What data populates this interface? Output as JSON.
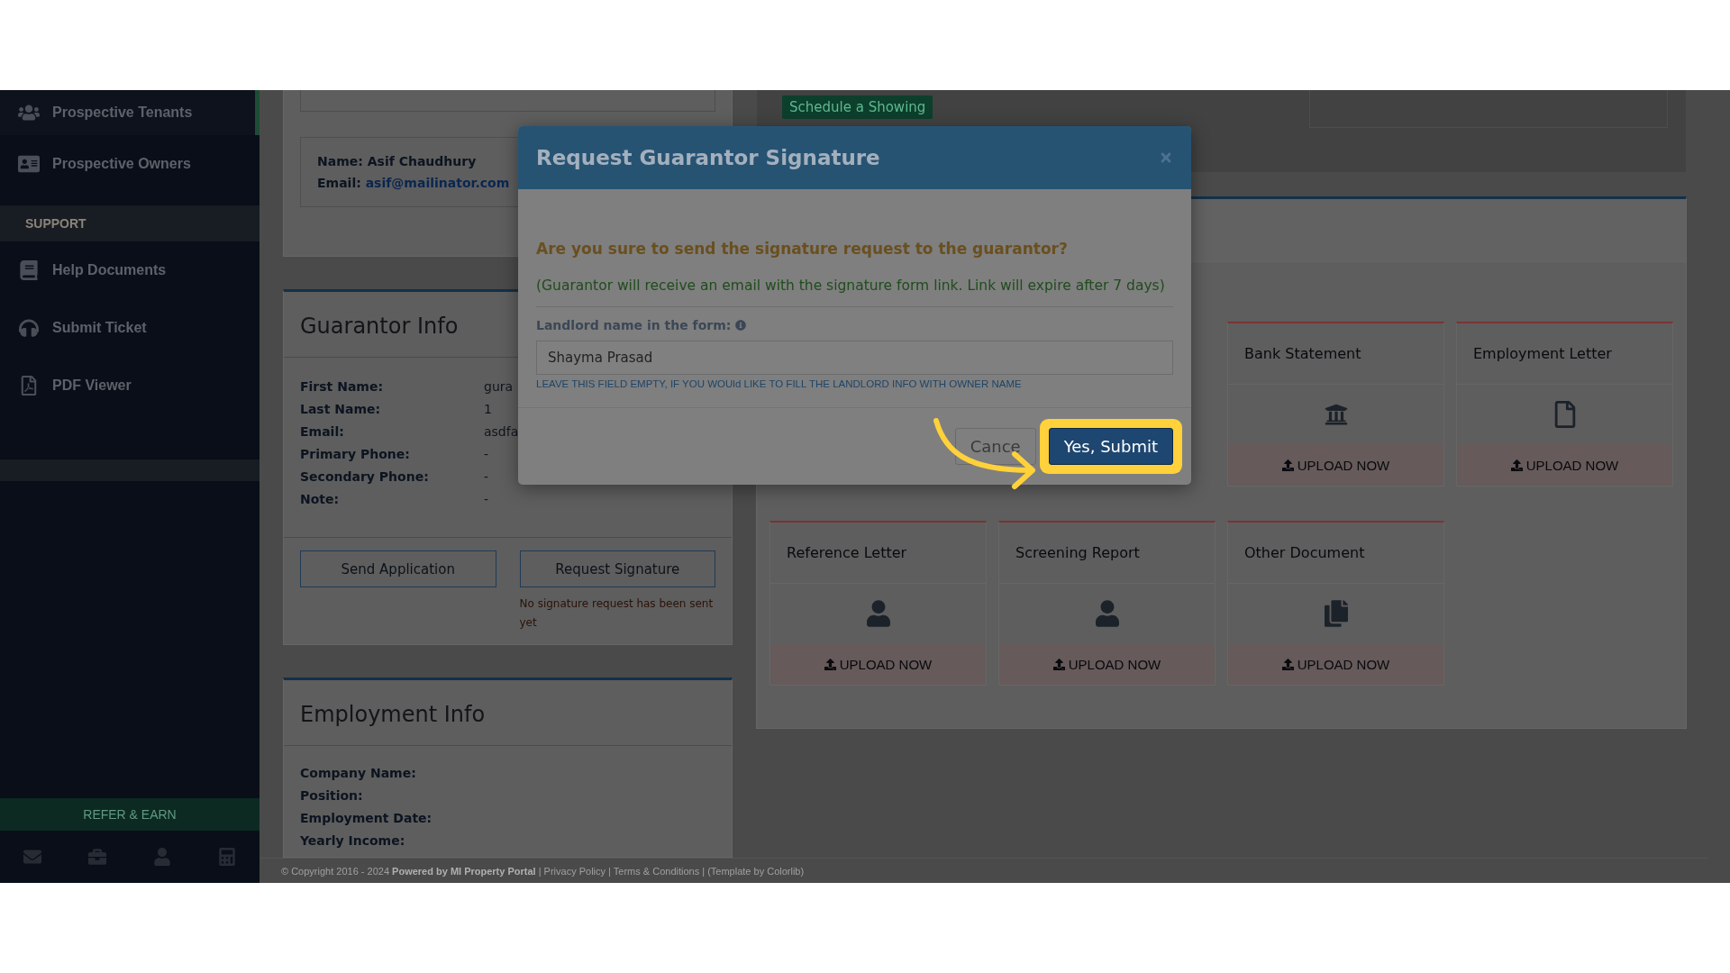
{
  "sidebar": {
    "items": [
      {
        "label": "Prospective Tenants",
        "selected": true
      },
      {
        "label": "Prospective Owners",
        "selected": false
      }
    ],
    "section": "SUPPORT",
    "support_items": [
      {
        "label": "Help Documents"
      },
      {
        "label": "Submit Ticket"
      },
      {
        "label": "PDF Viewer"
      }
    ],
    "refer_button": "REFER & EARN"
  },
  "contact": {
    "name": "Name: Asif Chaudhury",
    "email_label": "Email:",
    "email": "asif@mailinator.com"
  },
  "guarantor": {
    "title": "Guarantor Info",
    "fields": [
      {
        "label": "First Name:",
        "value": "gura"
      },
      {
        "label": "Last Name:",
        "value": "1"
      },
      {
        "label": "Email:",
        "value": "asdfa"
      },
      {
        "label": "Primary Phone:",
        "value": "-"
      },
      {
        "label": "Secondary Phone:",
        "value": "-"
      },
      {
        "label": "Note:",
        "value": "-"
      }
    ],
    "buttons": [
      "Send Application",
      "Request Signature"
    ],
    "signature_status": "No signature request has been sent yet"
  },
  "employment": {
    "title": "Employment Info",
    "fields": [
      "Company Name:",
      "Position:",
      "Employment Date:",
      "Yearly Income:"
    ]
  },
  "schedule_button": "Schedule a Showing",
  "documents": [
    {
      "title": "Bank Statement",
      "upload": "UPLOAD NOW"
    },
    {
      "title": "Employment Letter",
      "upload": "UPLOAD NOW"
    },
    {
      "title": "Reference Letter",
      "upload": "UPLOAD NOW"
    },
    {
      "title": "Screening Report",
      "upload": "UPLOAD NOW"
    },
    {
      "title": "Other Document",
      "upload": "UPLOAD NOW"
    }
  ],
  "modal": {
    "title": "Request Guarantor Signature",
    "question": "Are you sure to send the signature request to the guarantor?",
    "note": "(Guarantor will receive an email with the signature form link. Link will expire after 7 days)",
    "field_label": "Landlord name in the form:",
    "field_value": "Shayma Prasad",
    "hint": "LEAVE THIS FIELD EMPTY, IF YOU WOUld LIKE TO FILL THE LANDLORD INFO WITH OWNER NAME",
    "buttons": [
      {
        "label": "Cance",
        "kind": "cancel"
      },
      {
        "label": "Yes, Submit",
        "kind": "primary"
      }
    ]
  },
  "footer": "© Copyright 2016 - 2024 **Powered by MI Property Portal** | Privacy Policy | Terms & Conditions | (Template by Colorlib)"
}
